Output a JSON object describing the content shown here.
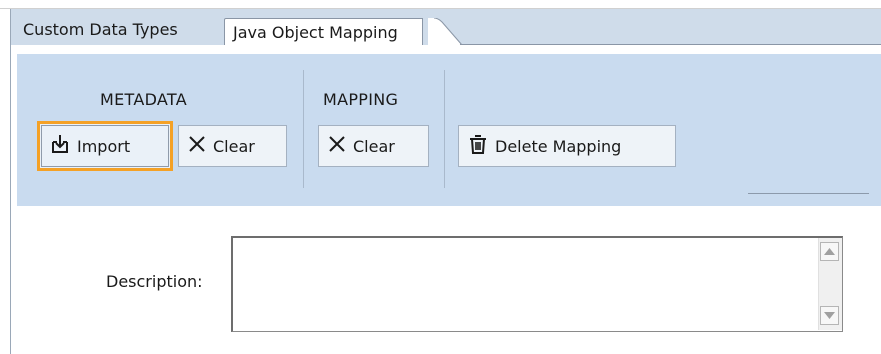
{
  "tabs": [
    {
      "label": "Custom Data Types"
    },
    {
      "label": "Java Object Mapping"
    }
  ],
  "ribbon": {
    "groups": {
      "metadata_label": "METADATA",
      "mapping_label": "MAPPING"
    },
    "buttons": {
      "import_label": "Import",
      "import_icon": "import-icon",
      "clear_metadata_label": "Clear",
      "clear_mapping_label": "Clear",
      "clear_icon": "close-icon",
      "delete_mapping_label": "Delete Mapping",
      "delete_icon": "trash-icon"
    }
  },
  "form": {
    "description_label": "Description:",
    "description_value": ""
  },
  "colors": {
    "ribbon_bg": "#c9dbef",
    "tabstrip_bg": "#cfdcea",
    "focus_border": "#f4a126"
  }
}
